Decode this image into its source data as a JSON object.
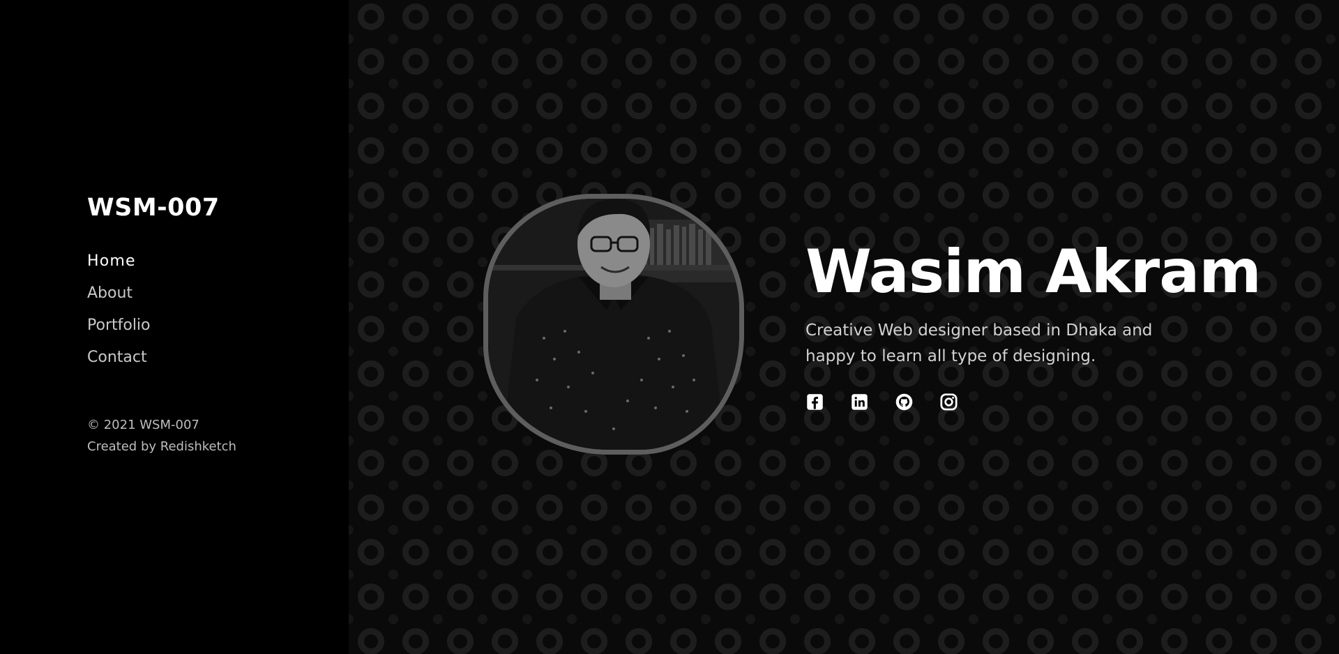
{
  "sidebar": {
    "brand": "WSM-007",
    "nav": [
      {
        "label": "Home",
        "active": true
      },
      {
        "label": "About",
        "active": false
      },
      {
        "label": "Portfolio",
        "active": false
      },
      {
        "label": "Contact",
        "active": false
      }
    ],
    "footer": {
      "copyright": "© 2021 WSM-007",
      "credit": "Created by Redishketch"
    }
  },
  "hero": {
    "name": "Wasim Akram",
    "tagline": "Creative Web designer based in Dhaka and happy to learn all type of designing.",
    "socials": [
      {
        "icon": "facebook-icon"
      },
      {
        "icon": "linkedin-icon"
      },
      {
        "icon": "github-icon"
      },
      {
        "icon": "instagram-icon"
      }
    ]
  },
  "colors": {
    "background": "#000000",
    "text_primary": "#ffffff",
    "text_muted": "#c9c9c9",
    "photo_border": "#5e5e5e"
  }
}
